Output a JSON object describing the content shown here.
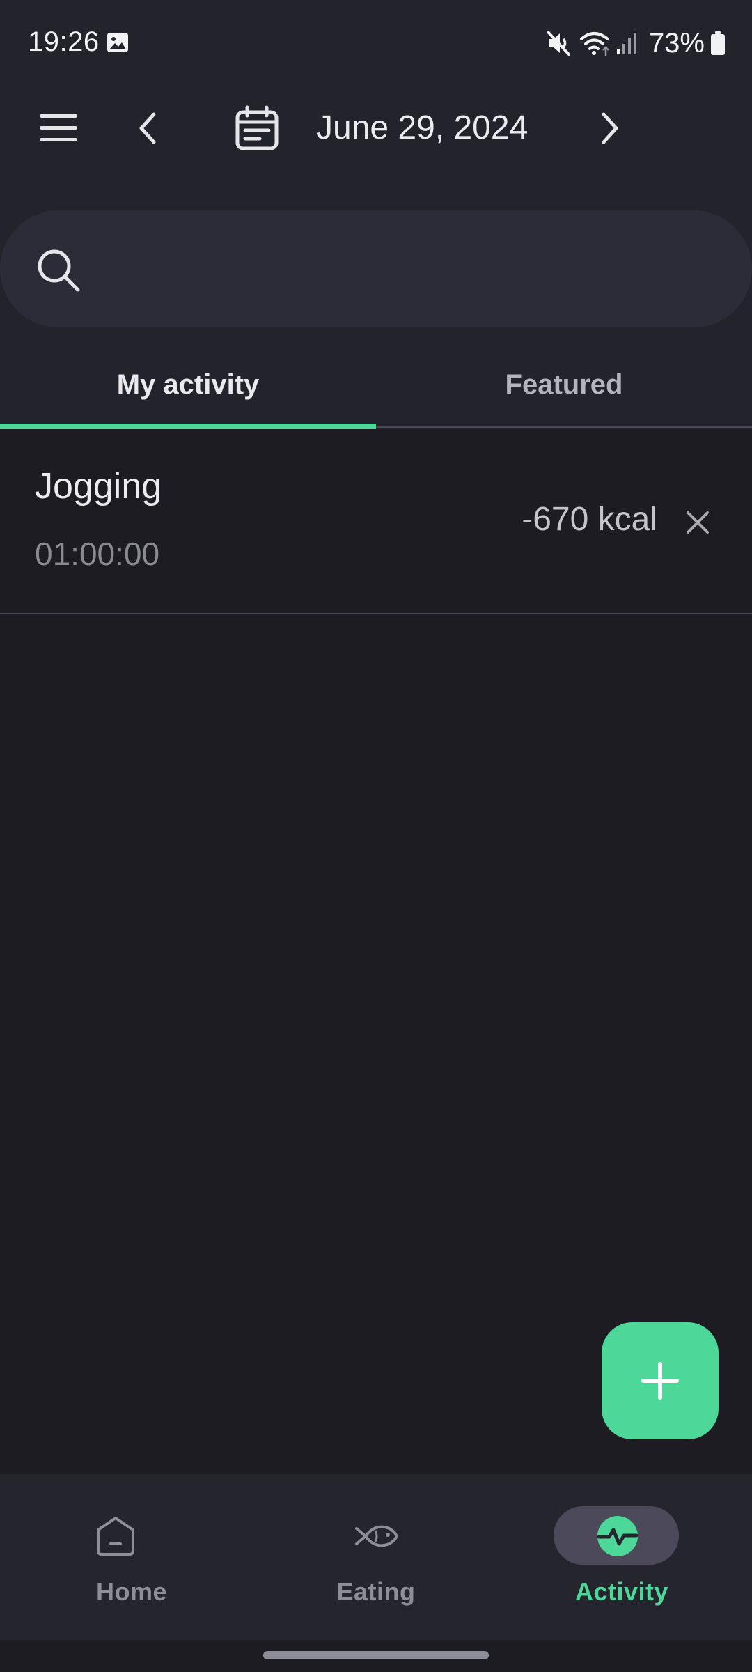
{
  "status_bar": {
    "time": "19:26",
    "battery_percent": "73%",
    "icons": [
      "gallery-icon",
      "mute-icon",
      "wifi-icon",
      "signal-icon",
      "battery-icon"
    ]
  },
  "header": {
    "date": "June 29, 2024",
    "icons": [
      "menu-icon",
      "chevron-left-icon",
      "calendar-icon",
      "chevron-right-icon"
    ]
  },
  "search": {
    "value": "",
    "placeholder": ""
  },
  "tabs": [
    {
      "label": "My activity",
      "active": true
    },
    {
      "label": "Featured",
      "active": false
    }
  ],
  "activities": [
    {
      "name": "Jogging",
      "duration": "01:00:00",
      "calories": "-670 kcal"
    }
  ],
  "fab": {
    "icon": "plus-icon"
  },
  "bottom_nav": [
    {
      "label": "Home",
      "icon": "home-icon",
      "active": false
    },
    {
      "label": "Eating",
      "icon": "fish-icon",
      "active": false
    },
    {
      "label": "Activity",
      "icon": "activity-pulse-icon",
      "active": true
    }
  ],
  "colors": {
    "accent": "#4dd89a",
    "background": "#1c1c22",
    "surface": "#23232c",
    "search_bg": "#2c2c38",
    "nav_bg": "#25252e",
    "nav_pill": "#4c4a5a"
  }
}
